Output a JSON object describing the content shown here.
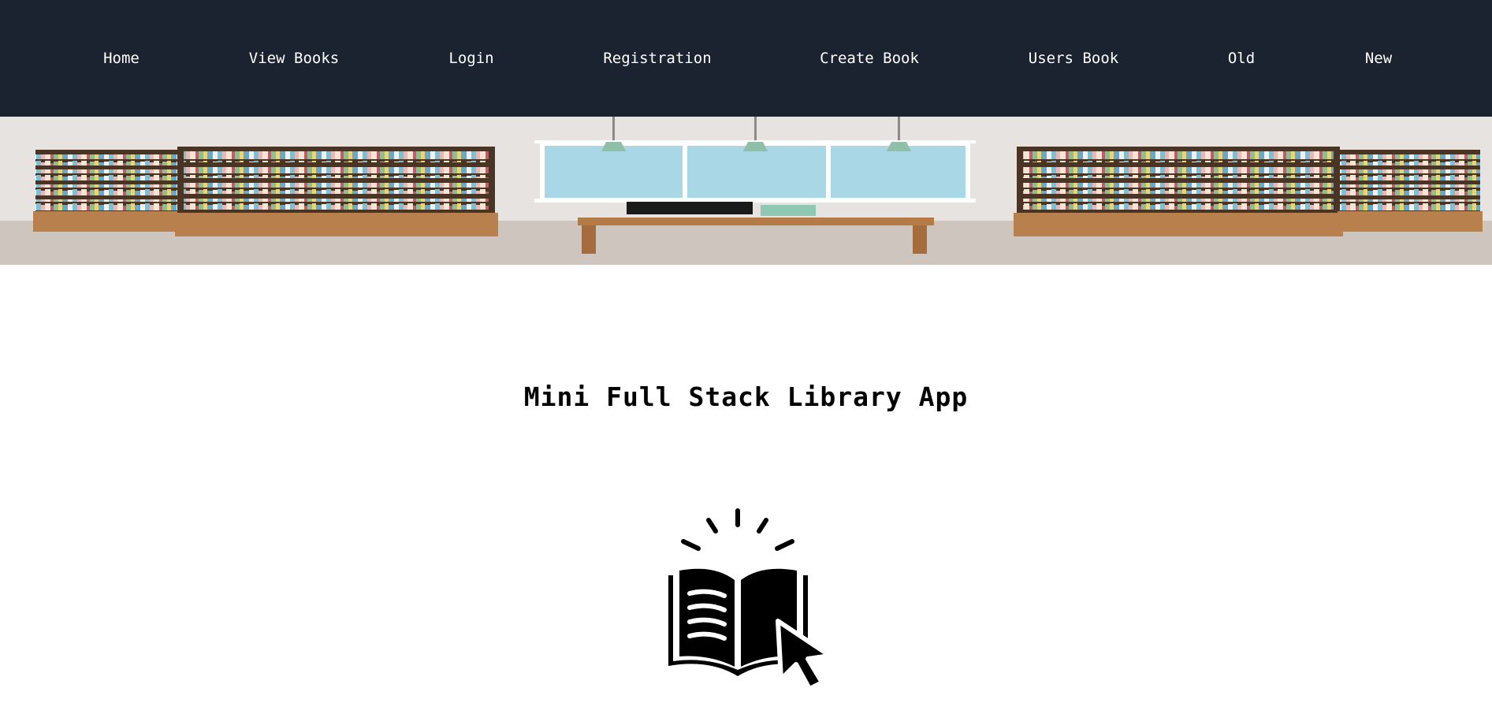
{
  "nav": {
    "items": [
      {
        "label": "Home"
      },
      {
        "label": "View Books"
      },
      {
        "label": "Login"
      },
      {
        "label": "Registration"
      },
      {
        "label": "Create Book"
      },
      {
        "label": "Users Book"
      },
      {
        "label": "Old"
      },
      {
        "label": "New"
      }
    ]
  },
  "banner": {
    "icon": "library-interior-illustration"
  },
  "main": {
    "title": "Mini Full Stack Library App",
    "icon": "open-book-click-icon"
  },
  "colors": {
    "navbar_bg": "#1b2330",
    "nav_text": "#ffffff",
    "page_bg": "#ffffff",
    "title_text": "#000000"
  }
}
